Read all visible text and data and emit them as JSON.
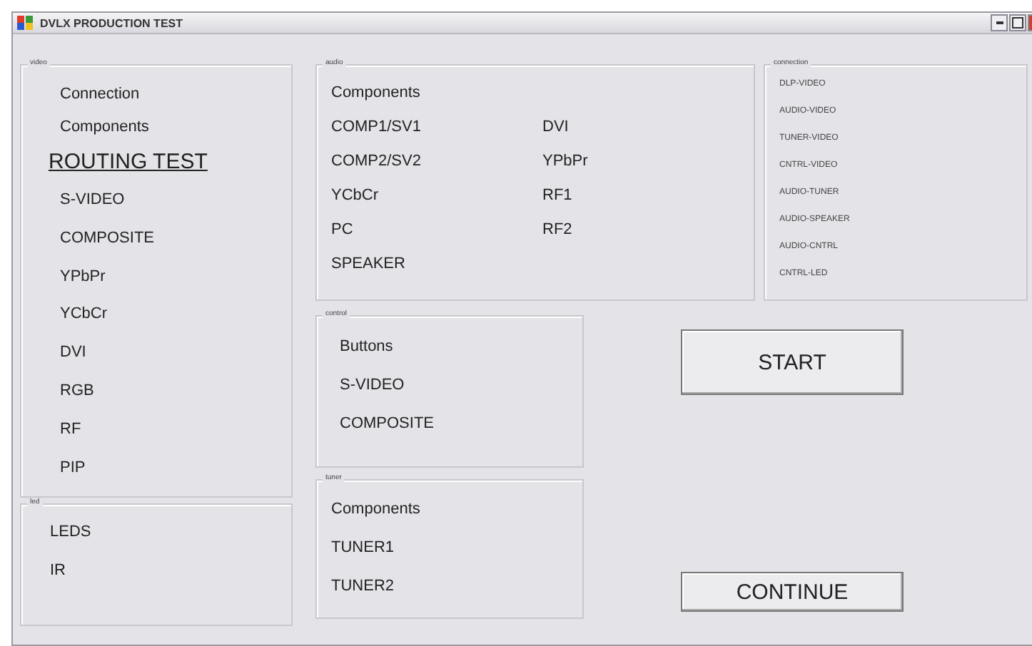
{
  "window": {
    "title": "DVLX PRODUCTION TEST"
  },
  "video": {
    "label": "video",
    "items": [
      {
        "text": "Connection",
        "kind": "item"
      },
      {
        "text": "Components",
        "kind": "item"
      },
      {
        "text": "ROUTING TEST",
        "kind": "heading"
      },
      {
        "text": "S-VIDEO",
        "kind": "item"
      },
      {
        "text": "COMPOSITE",
        "kind": "item"
      },
      {
        "text": "YPbPr",
        "kind": "item"
      },
      {
        "text": "YCbCr",
        "kind": "item"
      },
      {
        "text": "DVI",
        "kind": "item"
      },
      {
        "text": "RGB",
        "kind": "item"
      },
      {
        "text": "RF",
        "kind": "item"
      },
      {
        "text": "PIP",
        "kind": "item"
      }
    ]
  },
  "led": {
    "label": "led",
    "items": [
      "LEDS",
      "IR"
    ]
  },
  "audio": {
    "label": "audio",
    "column_1": [
      "Components",
      "COMP1/SV1",
      "COMP2/SV2",
      "YCbCr",
      "PC",
      "SPEAKER"
    ],
    "column_2": [
      "DVI",
      "YPbPr",
      "RF1",
      "RF2"
    ]
  },
  "connection": {
    "label": "connection",
    "items": [
      "DLP-VIDEO",
      "AUDIO-VIDEO",
      "TUNER-VIDEO",
      "CNTRL-VIDEO",
      "AUDIO-TUNER",
      "AUDIO-SPEAKER",
      "AUDIO-CNTRL",
      "CNTRL-LED"
    ]
  },
  "control": {
    "label": "control",
    "items": [
      "Buttons",
      "S-VIDEO",
      "COMPOSITE"
    ]
  },
  "tuner": {
    "label": "tuner",
    "items": [
      "Components",
      "TUNER1",
      "TUNER2"
    ]
  },
  "buttons": [
    "START",
    "CONTINUE"
  ]
}
